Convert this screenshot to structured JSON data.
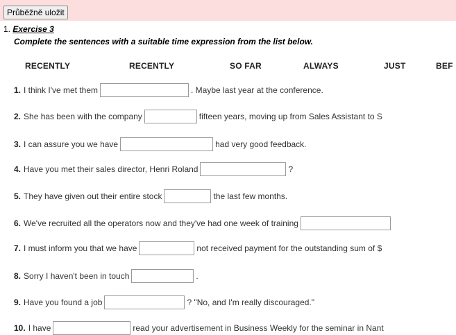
{
  "toolbar": {
    "save_label": "Průběžně uložit"
  },
  "question": {
    "number": "1.",
    "title": "Exercise 3",
    "instruction": "Complete the sentences with a suitable time expression from the list below."
  },
  "word_bank": [
    "RECENTLY",
    "RECENTLY",
    "SO FAR",
    "ALWAYS",
    "JUST",
    "BEF"
  ],
  "items": [
    {
      "num": "1.",
      "before": "I think I've met them",
      "after": ". Maybe last year at the conference.",
      "value": ""
    },
    {
      "num": "2.",
      "before": "She has been with the company",
      "after": "fifteen years, moving up from Sales Assistant to S",
      "value": ""
    },
    {
      "num": "3.",
      "before": "I can assure you we have",
      "after": "had very good feedback.",
      "value": ""
    },
    {
      "num": "4.",
      "before": "Have you met their sales director, Henri Roland",
      "after": "?",
      "value": ""
    },
    {
      "num": "5.",
      "before": "They have given out their entire stock",
      "after": "the last few months.",
      "value": ""
    },
    {
      "num": "6.",
      "before": "We've recruited all the operators now and they've had one week of training",
      "after": "",
      "value": ""
    },
    {
      "num": "7.",
      "before": "I must inform you that we have",
      "after": "not received payment for the outstanding sum of $",
      "value": ""
    },
    {
      "num": "8.",
      "before": "Sorry I haven't been in touch",
      "after": ".",
      "value": ""
    },
    {
      "num": "9.",
      "before": "Have you found a job",
      "after": "? \"No, and I'm really discouraged.\"",
      "value": ""
    },
    {
      "num": "10.",
      "before": "I have",
      "after": "read your advertisement in Business Weekly for the seminar in Nant",
      "value": ""
    }
  ]
}
